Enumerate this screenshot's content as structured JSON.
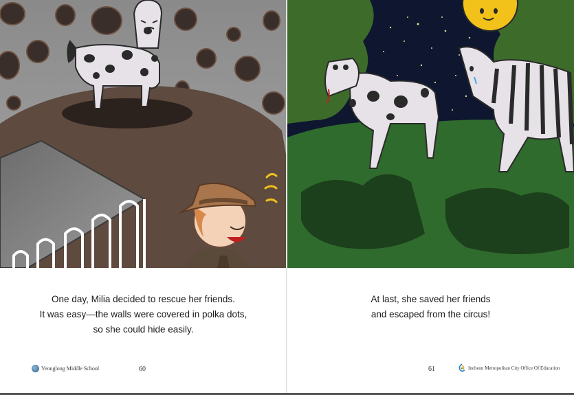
{
  "left_page": {
    "text_lines": [
      "One day, Milia decided to rescue her friends.",
      "It was easy—the walls were covered in polka dots,",
      "so she could hide easily."
    ],
    "footer_label": "Yeonglong Middle School",
    "page_number": "60",
    "logo_icon": "school-emblem-icon"
  },
  "right_page": {
    "text_lines": [
      "At last, she saved her friends",
      "and escaped from the circus!"
    ],
    "footer_label": "Incheon Metropolitan City Office Of Education",
    "page_number": "61",
    "logo_icon": "education-office-icon"
  },
  "colors": {
    "wall_gray": "#8e8e8e",
    "ground_brown": "#5e4a3e",
    "night_sky": "#0e1630",
    "grass_green": "#2f6b2c",
    "moon_yellow": "#f2c21a"
  }
}
